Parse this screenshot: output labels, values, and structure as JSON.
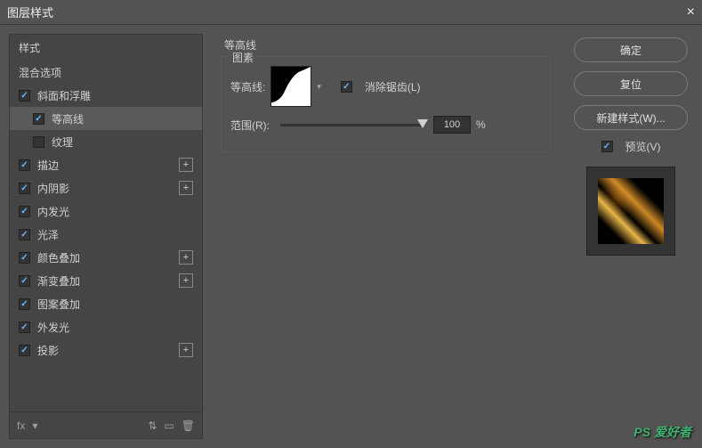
{
  "title": "图层样式",
  "left": {
    "header": "样式",
    "blend": "混合选项",
    "items": [
      {
        "label": "斜面和浮雕",
        "checked": true,
        "sub": false,
        "add": false
      },
      {
        "label": "等高线",
        "checked": true,
        "sub": true,
        "add": false,
        "selected": true
      },
      {
        "label": "纹理",
        "checked": false,
        "sub": true,
        "add": false
      },
      {
        "label": "描边",
        "checked": true,
        "sub": false,
        "add": true
      },
      {
        "label": "内阴影",
        "checked": true,
        "sub": false,
        "add": true
      },
      {
        "label": "内发光",
        "checked": true,
        "sub": false,
        "add": false
      },
      {
        "label": "光泽",
        "checked": true,
        "sub": false,
        "add": false
      },
      {
        "label": "颜色叠加",
        "checked": true,
        "sub": false,
        "add": true
      },
      {
        "label": "渐变叠加",
        "checked": true,
        "sub": false,
        "add": true
      },
      {
        "label": "图案叠加",
        "checked": true,
        "sub": false,
        "add": false
      },
      {
        "label": "外发光",
        "checked": true,
        "sub": false,
        "add": false
      },
      {
        "label": "投影",
        "checked": true,
        "sub": false,
        "add": true
      }
    ],
    "footer_fx": "fx"
  },
  "center": {
    "section_title": "等高线",
    "fieldset_title": "图素",
    "contour_label": "等高线:",
    "antialias_label": "消除锯齿(L)",
    "antialias_checked": true,
    "range_label": "范围(R):",
    "range_value": "100",
    "range_unit": "%"
  },
  "right": {
    "ok": "确定",
    "cancel": "复位",
    "newstyle": "新建样式(W)...",
    "preview_label": "预览(V)",
    "preview_checked": true
  },
  "watermark": "PS 爱好者"
}
